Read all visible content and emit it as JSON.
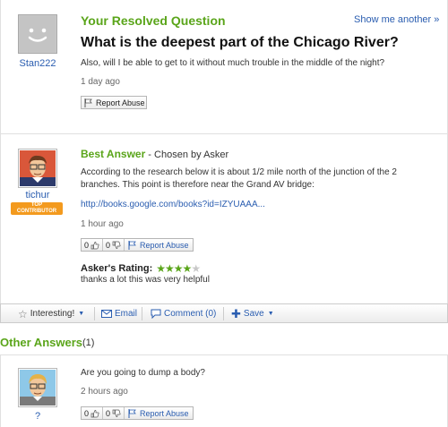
{
  "question": {
    "section_title": "Your Resolved Question",
    "show_more": "Show me another »",
    "title": "What is the deepest part of the Chicago River?",
    "details": "Also, will I be able to get to it without much trouble in the middle of the night?",
    "time": "1 day ago",
    "report_label": "Report Abuse",
    "user": "Stan222"
  },
  "best_answer": {
    "title": "Best Answer",
    "chosen_by": " - Chosen by Asker",
    "text_line1": "According to the research below it is about 1/2 mile north of the junction of the 2",
    "text_line2": "branches. This point is therefore near the Grand AV bridge:",
    "link": "http://books.google.com/books?id=IZYUAAA...",
    "time": "1 hour ago",
    "thumbs_up": "0",
    "thumbs_down": "0",
    "report_label": "Report Abuse",
    "rating_label": "Asker's Rating:",
    "rating_stars": 4,
    "rating_max": 5,
    "rating_comment": "thanks a lot this was very helpful",
    "user": "tichur",
    "badge_line1": "TOP",
    "badge_line2": "CONTRIBUTOR"
  },
  "actions": {
    "interesting": "Interesting!",
    "email": "Email",
    "comment": "Comment (0)",
    "save": "Save"
  },
  "other_answers": {
    "title": "Other Answers",
    "count": "(1)",
    "items": [
      {
        "text": "Are you going to dump a body?",
        "time": "2 hours ago",
        "thumbs_up": "0",
        "thumbs_down": "0",
        "report_label": "Report Abuse",
        "user": "?"
      }
    ]
  },
  "colors": {
    "green": "#5aa51a",
    "link": "#2a5db0",
    "star": "#5aa51a",
    "badge": "#f39a1e"
  }
}
